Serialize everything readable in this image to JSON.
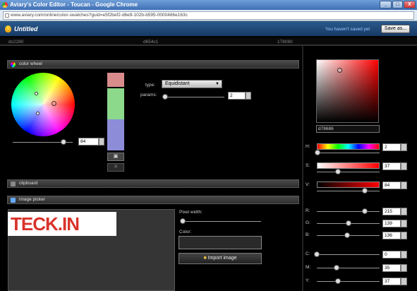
{
  "window": {
    "title": "Aviary's Color Editor - Toucan - Google Chrome",
    "minimize": "_",
    "maximize": "□",
    "close": "X"
  },
  "url": "www.aviary.com/online/color-swatches?guid=e5f2bef2-d6e9-102b-b595-0000486e163c",
  "app": {
    "doc_title": "Untitled",
    "save_status": "You haven't saved yet",
    "save_button": "Save as..."
  },
  "swatches": [
    "dc2280",
    "d654c1",
    "178080"
  ],
  "color_wheel": {
    "header": "color wheel",
    "type_label": "type:",
    "type_value": "Equidistant",
    "params_label": "params:",
    "params_value": "2",
    "brightness_value": "84",
    "swatch_colors": [
      "#d98c8c",
      "#8cd98c",
      "#8c8cd9"
    ]
  },
  "clipboard": {
    "header": "clipboard"
  },
  "image_picker": {
    "header": "image picker",
    "pixel_width_label": "Pixel width:",
    "color_label": "Color:",
    "import_button": "Import image",
    "watermark": "TECK.IN"
  },
  "picker": {
    "hex": "d78686",
    "channels": [
      {
        "label": "H:",
        "value": "2",
        "level": 0.01
      },
      {
        "label": "S:",
        "value": "37",
        "level": 0.37
      },
      {
        "label": "V:",
        "value": "84",
        "level": 0.84
      },
      {
        "label": "R:",
        "value": "215",
        "level": 0.84
      },
      {
        "label": "G:",
        "value": "139",
        "level": 0.55
      },
      {
        "label": "B:",
        "value": "136",
        "level": 0.53
      },
      {
        "label": "C:",
        "value": "0",
        "level": 0.0
      },
      {
        "label": "M:",
        "value": "35",
        "level": 0.35
      },
      {
        "label": "Y:",
        "value": "37",
        "level": 0.37
      }
    ]
  }
}
